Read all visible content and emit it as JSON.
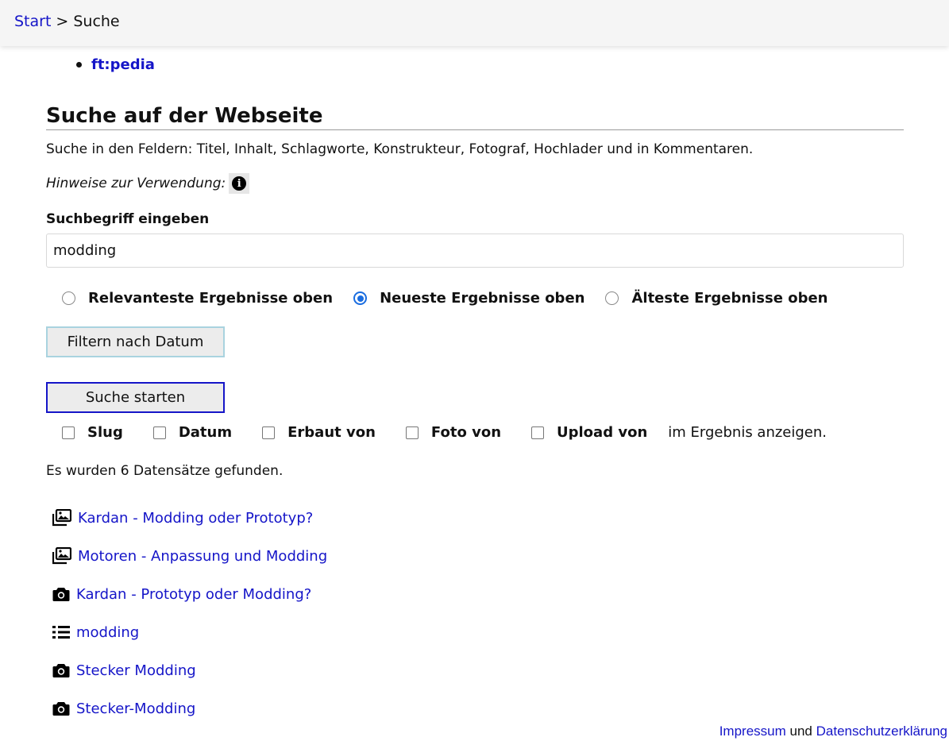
{
  "breadcrumb": {
    "home": "Start",
    "separator": ">",
    "current": "Suche"
  },
  "menu": {
    "items": [
      {
        "label": "ft:pedia"
      }
    ]
  },
  "heading": "Suche auf der Webseite",
  "description": "Suche in den Feldern: Titel, Inhalt, Schlagworte, Konstrukteur, Fotograf, Hochlader und in Kommentaren.",
  "hint_label": "Hinweise zur Verwendung:",
  "search": {
    "label": "Suchbegriff eingeben",
    "value": "modding"
  },
  "sort": {
    "options": [
      {
        "label": "Relevanteste Ergebnisse oben",
        "checked": false
      },
      {
        "label": "Neueste Ergebnisse oben",
        "checked": true
      },
      {
        "label": "Älteste Ergebnisse oben",
        "checked": false
      }
    ]
  },
  "buttons": {
    "filter": "Filtern nach Datum",
    "search": "Suche starten"
  },
  "columns": {
    "options": [
      {
        "label": "Slug"
      },
      {
        "label": "Datum"
      },
      {
        "label": "Erbaut von"
      },
      {
        "label": "Foto von"
      },
      {
        "label": "Upload von"
      }
    ],
    "suffix": "im Ergebnis anzeigen."
  },
  "result_count": "Es wurden 6 Datensätze gefunden.",
  "results": [
    {
      "icon": "gallery-icon",
      "title": "Kardan - Modding oder Prototyp?"
    },
    {
      "icon": "gallery-icon",
      "title": "Motoren - Anpassung und Modding"
    },
    {
      "icon": "camera-icon",
      "title": "Kardan - Prototyp oder Modding?"
    },
    {
      "icon": "list-icon",
      "title": "modding"
    },
    {
      "icon": "camera-icon",
      "title": "Stecker Modding"
    },
    {
      "icon": "camera-icon",
      "title": "Stecker-Modding"
    }
  ],
  "footer": {
    "imprint": "Impressum",
    "and": "und",
    "privacy": "Datenschutzerklärung"
  },
  "colors": {
    "link": "#1515c8",
    "radio_checked": "#1a6de0",
    "filter_border": "#a9d3df",
    "topbar_bg": "#f5f5f5"
  }
}
